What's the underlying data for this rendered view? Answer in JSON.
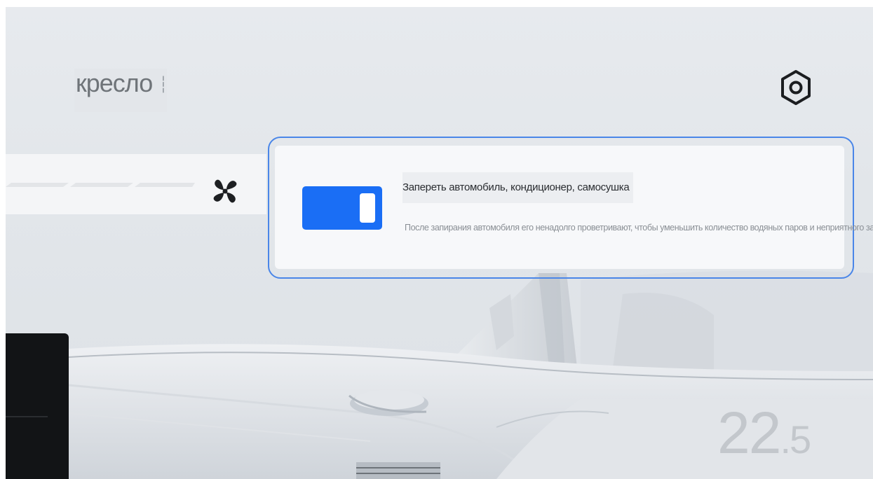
{
  "header": {
    "title": "кресло",
    "settings_icon": "settings-hexagon-icon"
  },
  "fan": {
    "icon": "fan-icon",
    "level_segments_lit": 0
  },
  "feature_card": {
    "toggle_state": "on",
    "accent_color": "#1a6ef5",
    "title": "Запереть автомобиль, кондиционер, самосушка",
    "description": "После запирания автомобиля его ненадолго проветривают, чтобы уменьшить количество водяных паров и неприятного запаха."
  },
  "temperature": {
    "integer": "22",
    "decimal": ".5"
  }
}
